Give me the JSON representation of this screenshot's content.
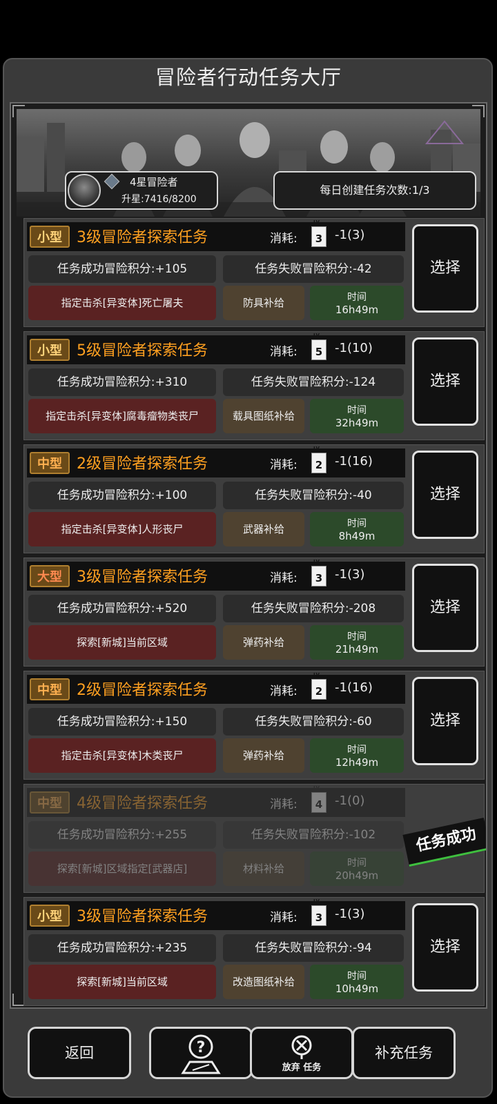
{
  "title": "冒险者行动任务大厅",
  "profile": {
    "rank": "4星冒险者",
    "upgrade": "升星:7416/8200"
  },
  "daily": "每日创建任务次数:1/3",
  "cost_label": "消耗:",
  "select_label": "选择",
  "time_label": "时间",
  "tasks": [
    {
      "size": "小型",
      "level": "3",
      "title": "3级冒险者探索任务",
      "cost": "-1(3)",
      "success": "任务成功冒险积分:+105",
      "fail": "任务失败冒险积分:-42",
      "target": "指定击杀[异变体]死亡屠夫",
      "supply": "防具补给",
      "time": "16h49m"
    },
    {
      "size": "小型",
      "level": "5",
      "title": "5级冒险者探索任务",
      "cost": "-1(10)",
      "success": "任务成功冒险积分:+310",
      "fail": "任务失败冒险积分:-124",
      "target": "指定击杀[异变体]腐毒瘤物类丧尸",
      "supply": "载具图纸补给",
      "time": "32h49m"
    },
    {
      "size": "中型",
      "level": "2",
      "title": "2级冒险者探索任务",
      "cost": "-1(16)",
      "success": "任务成功冒险积分:+100",
      "fail": "任务失败冒险积分:-40",
      "target": "指定击杀[异变体]人形丧尸",
      "supply": "武器补给",
      "time": "8h49m"
    },
    {
      "size": "大型",
      "level": "3",
      "title": "3级冒险者探索任务",
      "cost": "-1(3)",
      "success": "任务成功冒险积分:+520",
      "fail": "任务失败冒险积分:-208",
      "target": "探索[新城]当前区域",
      "supply": "弹药补给",
      "time": "21h49m"
    },
    {
      "size": "中型",
      "level": "2",
      "title": "2级冒险者探索任务",
      "cost": "-1(16)",
      "success": "任务成功冒险积分:+150",
      "fail": "任务失败冒险积分:-60",
      "target": "指定击杀[异变体]木类丧尸",
      "supply": "弹药补给",
      "time": "12h49m"
    },
    {
      "size": "中型",
      "level": "4",
      "title": "4级冒险者探索任务",
      "cost": "-1(0)",
      "success": "任务成功冒险积分:+255",
      "fail": "任务失败冒险积分:-102",
      "target": "探索[新城]区域指定[武器店]",
      "supply": "材料补给",
      "time": "20h49m",
      "status": "任务成功"
    },
    {
      "size": "小型",
      "level": "3",
      "title": "3级冒险者探索任务",
      "cost": "-1(3)",
      "success": "任务成功冒险积分:+235",
      "fail": "任务失败冒险积分:-94",
      "target": "探索[新城]当前区域",
      "supply": "改造图纸补给",
      "time": "10h49m"
    }
  ],
  "footer": {
    "back": "返回",
    "abandon": "放弃 任务",
    "refill": "补充任务"
  },
  "icons": {
    "help": "help-map-icon",
    "abandon": "abandon-x-icon"
  }
}
